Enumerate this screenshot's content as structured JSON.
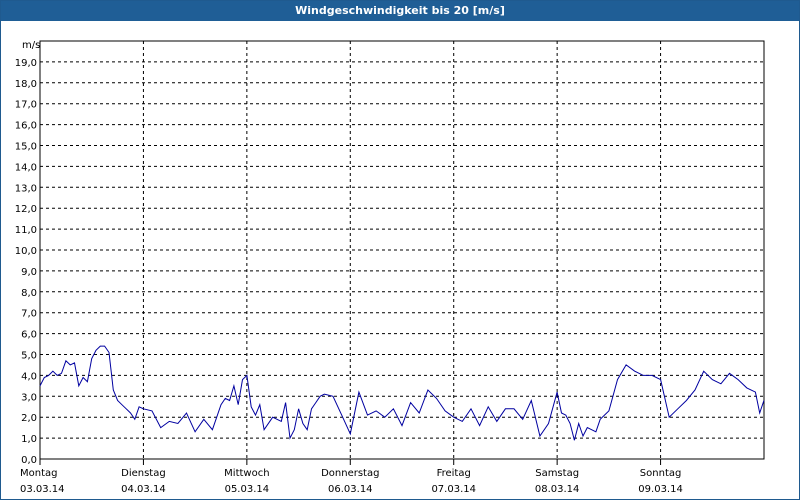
{
  "window": {
    "title": "Windgeschwindigkeit bis 20 [m/s]"
  },
  "chart_data": {
    "type": "line",
    "title": "Windgeschwindigkeit bis 20 [m/s]",
    "ylabel": "m/s",
    "xlabel": "",
    "ylim": [
      0,
      20
    ],
    "xlim": [
      "2014-03-03 00:00",
      "2014-03-10 00:00"
    ],
    "grid": true,
    "line_color": "#0000a0",
    "y_ticks": [
      "0,0",
      "1,0",
      "2,0",
      "3,0",
      "4,0",
      "5,0",
      "6,0",
      "7,0",
      "8,0",
      "9,0",
      "10,0",
      "11,0",
      "12,0",
      "13,0",
      "14,0",
      "15,0",
      "16,0",
      "17,0",
      "18,0",
      "19,0"
    ],
    "x_ticks": [
      {
        "day": "Montag",
        "date": "03.03.14"
      },
      {
        "day": "Dienstag",
        "date": "04.03.14"
      },
      {
        "day": "Mittwoch",
        "date": "05.03.14"
      },
      {
        "day": "Donnerstag",
        "date": "06.03.14"
      },
      {
        "day": "Freitag",
        "date": "07.03.14"
      },
      {
        "day": "Samstag",
        "date": "08.03.14"
      },
      {
        "day": "Sonntag",
        "date": "09.03.14"
      }
    ],
    "series": [
      {
        "x": [
          "2014-03-03 00:00",
          "2014-03-03 01:00",
          "2014-03-03 02:00",
          "2014-03-03 03:00",
          "2014-03-03 04:00",
          "2014-03-03 05:00",
          "2014-03-03 06:00",
          "2014-03-03 07:00",
          "2014-03-03 08:00",
          "2014-03-03 09:00",
          "2014-03-03 10:00",
          "2014-03-03 11:00",
          "2014-03-03 12:00",
          "2014-03-03 13:00",
          "2014-03-03 14:00",
          "2014-03-03 15:00",
          "2014-03-03 16:00",
          "2014-03-03 17:00",
          "2014-03-03 18:00",
          "2014-03-03 19:00",
          "2014-03-03 20:00",
          "2014-03-03 21:00",
          "2014-03-03 22:00",
          "2014-03-03 23:00",
          "2014-03-04 00:00",
          "2014-03-04 02:00",
          "2014-03-04 04:00",
          "2014-03-04 06:00",
          "2014-03-04 08:00",
          "2014-03-04 10:00",
          "2014-03-04 12:00",
          "2014-03-04 14:00",
          "2014-03-04 16:00",
          "2014-03-04 18:00",
          "2014-03-04 19:00",
          "2014-03-04 20:00",
          "2014-03-04 21:00",
          "2014-03-04 22:00",
          "2014-03-04 23:00",
          "2014-03-05 00:00",
          "2014-03-05 01:00",
          "2014-03-05 02:00",
          "2014-03-05 03:00",
          "2014-03-05 04:00",
          "2014-03-05 06:00",
          "2014-03-05 08:00",
          "2014-03-05 09:00",
          "2014-03-05 10:00",
          "2014-03-05 11:00",
          "2014-03-05 12:00",
          "2014-03-05 13:00",
          "2014-03-05 14:00",
          "2014-03-05 15:00",
          "2014-03-05 16:00",
          "2014-03-05 17:00",
          "2014-03-05 18:00",
          "2014-03-05 20:00",
          "2014-03-05 22:00",
          "2014-03-06 00:00",
          "2014-03-06 02:00",
          "2014-03-06 04:00",
          "2014-03-06 06:00",
          "2014-03-06 08:00",
          "2014-03-06 10:00",
          "2014-03-06 12:00",
          "2014-03-06 14:00",
          "2014-03-06 16:00",
          "2014-03-06 18:00",
          "2014-03-06 20:00",
          "2014-03-06 22:00",
          "2014-03-07 00:00",
          "2014-03-07 02:00",
          "2014-03-07 04:00",
          "2014-03-07 06:00",
          "2014-03-07 08:00",
          "2014-03-07 10:00",
          "2014-03-07 12:00",
          "2014-03-07 14:00",
          "2014-03-07 16:00",
          "2014-03-07 18:00",
          "2014-03-07 20:00",
          "2014-03-07 22:00",
          "2014-03-08 00:00",
          "2014-03-08 01:00",
          "2014-03-08 02:00",
          "2014-03-08 03:00",
          "2014-03-08 04:00",
          "2014-03-08 05:00",
          "2014-03-08 06:00",
          "2014-03-08 07:00",
          "2014-03-08 08:00",
          "2014-03-08 09:00",
          "2014-03-08 10:00",
          "2014-03-08 12:00",
          "2014-03-08 14:00",
          "2014-03-08 16:00",
          "2014-03-08 18:00",
          "2014-03-08 20:00",
          "2014-03-08 22:00",
          "2014-03-09 00:00",
          "2014-03-09 02:00",
          "2014-03-09 04:00",
          "2014-03-09 06:00",
          "2014-03-09 08:00",
          "2014-03-09 10:00",
          "2014-03-09 12:00",
          "2014-03-09 14:00",
          "2014-03-09 16:00",
          "2014-03-09 18:00",
          "2014-03-09 20:00",
          "2014-03-09 22:00",
          "2014-03-09 23:00",
          "2014-03-09 23:59"
        ],
        "y": [
          3.5,
          3.9,
          4.0,
          4.2,
          4.0,
          4.1,
          4.7,
          4.5,
          4.6,
          3.5,
          3.9,
          3.7,
          4.8,
          5.2,
          5.4,
          5.4,
          5.1,
          3.3,
          2.8,
          2.6,
          2.4,
          2.2,
          1.9,
          2.5,
          2.4,
          2.3,
          1.5,
          1.8,
          1.7,
          2.2,
          1.3,
          1.9,
          1.4,
          2.6,
          2.9,
          2.8,
          3.5,
          2.6,
          3.8,
          4.0,
          2.5,
          2.1,
          2.6,
          1.4,
          2.0,
          1.8,
          2.7,
          1.0,
          1.4,
          2.4,
          1.7,
          1.4,
          2.4,
          2.7,
          3.0,
          3.1,
          3.0,
          2.1,
          1.2,
          3.2,
          2.1,
          2.3,
          2.0,
          2.4,
          1.6,
          2.7,
          2.2,
          3.3,
          2.9,
          2.3,
          2.0,
          1.8,
          2.4,
          1.6,
          2.5,
          1.8,
          2.4,
          2.4,
          1.9,
          2.8,
          1.1,
          1.7,
          3.2,
          2.2,
          2.1,
          1.7,
          0.9,
          1.7,
          1.1,
          1.5,
          1.4,
          1.3,
          1.9,
          2.3,
          3.8,
          4.5,
          4.2,
          4.0,
          4.0,
          3.8,
          2.0,
          2.4,
          2.8,
          3.3,
          4.2,
          3.8,
          3.6,
          4.1,
          3.8,
          3.4,
          3.2,
          2.2,
          2.8
        ]
      }
    ]
  }
}
